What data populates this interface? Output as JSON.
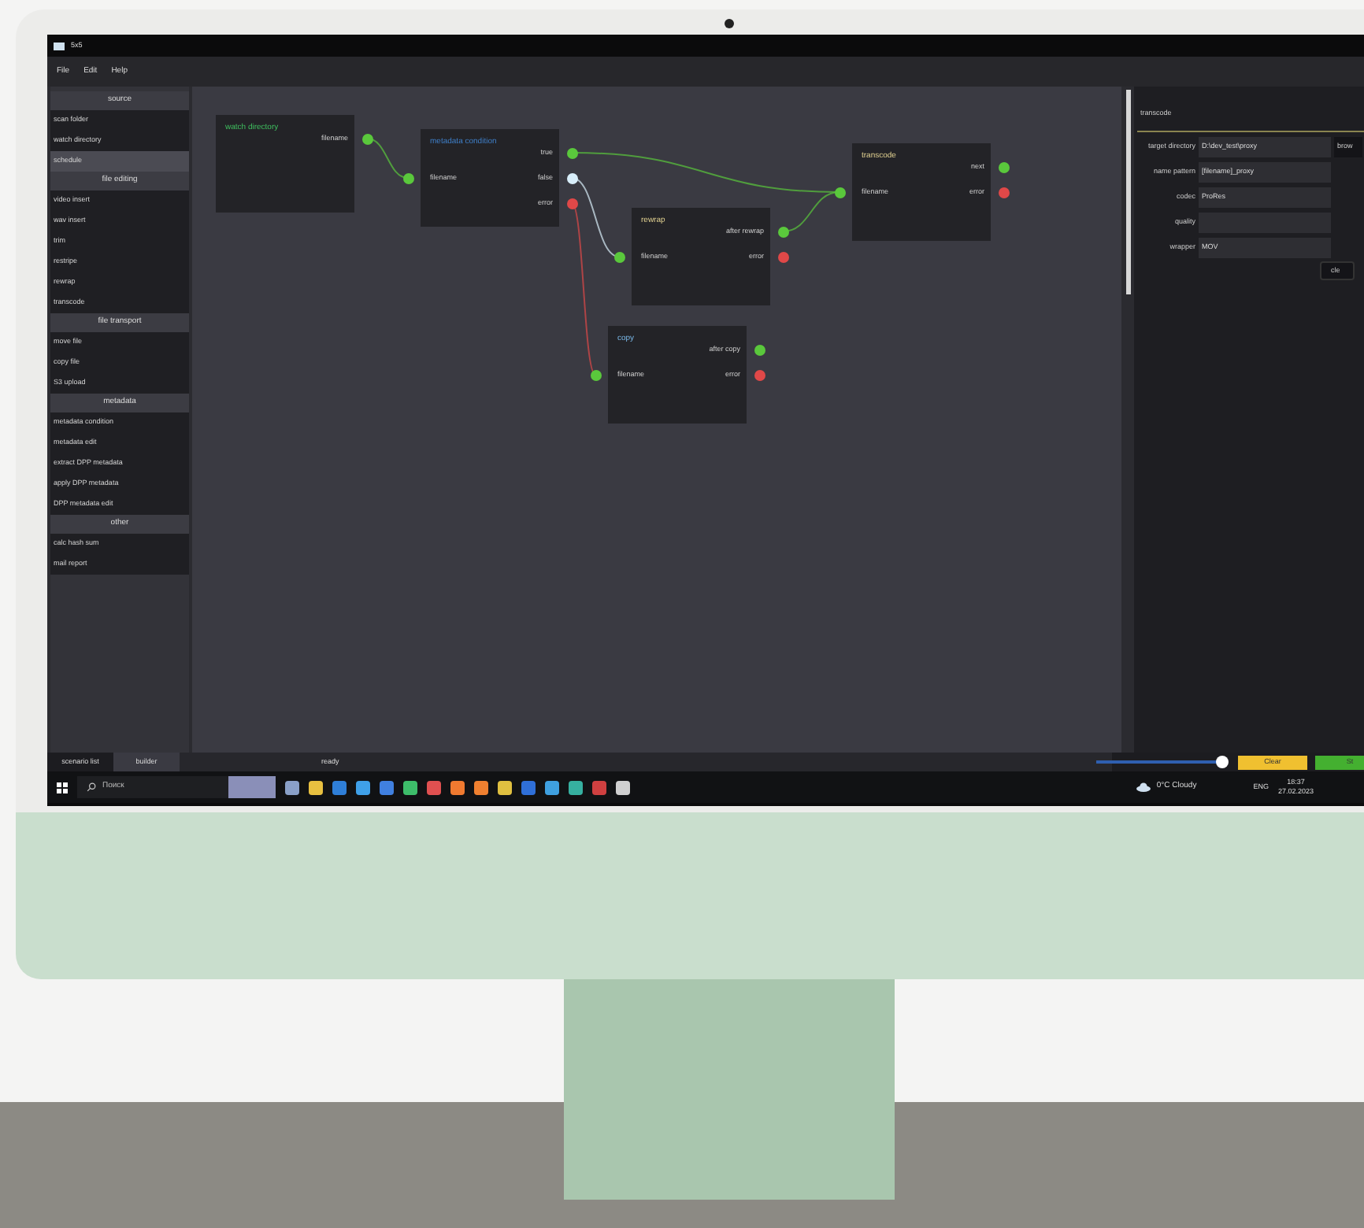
{
  "window": {
    "title": "5x5"
  },
  "menu": [
    "File",
    "Edit",
    "Help"
  ],
  "sidebar": [
    {
      "title": "source",
      "items": [
        {
          "label": "scan folder",
          "selected": false
        },
        {
          "label": "watch directory",
          "selected": false
        },
        {
          "label": "schedule",
          "selected": true
        }
      ]
    },
    {
      "title": "file editing",
      "items": [
        {
          "label": "video insert",
          "selected": false
        },
        {
          "label": "wav insert",
          "selected": false
        },
        {
          "label": "trim",
          "selected": false
        },
        {
          "label": "restripe",
          "selected": false
        },
        {
          "label": "rewrap",
          "selected": false
        },
        {
          "label": "transcode",
          "selected": false
        }
      ]
    },
    {
      "title": "file transport",
      "items": [
        {
          "label": "move file",
          "selected": false
        },
        {
          "label": "copy file",
          "selected": false
        },
        {
          "label": "S3 upload",
          "selected": false
        }
      ]
    },
    {
      "title": "metadata",
      "items": [
        {
          "label": "metadata condition",
          "selected": false
        },
        {
          "label": "metadata edit",
          "selected": false
        },
        {
          "label": "extract DPP metadata",
          "selected": false
        },
        {
          "label": "apply DPP metadata",
          "selected": false
        },
        {
          "label": "DPP metadata edit",
          "selected": false
        }
      ]
    },
    {
      "title": "other",
      "items": [
        {
          "label": "calc hash sum",
          "selected": false
        },
        {
          "label": "mail report",
          "selected": false
        }
      ]
    }
  ],
  "nodes": [
    {
      "title": "watch directory",
      "kind": "source",
      "outputs": [
        {
          "label": "filename",
          "color": "#5ac83c"
        }
      ]
    },
    {
      "title": "metadata condition",
      "kind": "metadata",
      "inputs": [
        {
          "label": "filename",
          "color": "#5ac83c"
        }
      ],
      "outputs": [
        {
          "label": "true",
          "color": "#5ac83c"
        },
        {
          "label": "false",
          "color": "#d8eefa"
        },
        {
          "label": "error",
          "color": "#e04848"
        }
      ]
    },
    {
      "title": "rewrap",
      "kind": "editing",
      "inputs": [
        {
          "label": "filename",
          "color": "#5ac83c"
        }
      ],
      "outputs": [
        {
          "label": "after rewrap",
          "color": "#5ac83c"
        },
        {
          "label": "error",
          "color": "#e04848"
        }
      ]
    },
    {
      "title": "copy",
      "kind": "transport",
      "inputs": [
        {
          "label": "filename",
          "color": "#5ac83c"
        }
      ],
      "outputs": [
        {
          "label": "after copy",
          "color": "#5ac83c"
        },
        {
          "label": "error",
          "color": "#e04848"
        }
      ]
    },
    {
      "title": "transcode",
      "kind": "editing",
      "inputs": [
        {
          "label": "filename",
          "color": "#5ac83c"
        }
      ],
      "outputs": [
        {
          "label": "next",
          "color": "#5ac83c"
        },
        {
          "label": "error",
          "color": "#e04848"
        }
      ]
    }
  ],
  "properties": {
    "title": "transcode",
    "fields": [
      {
        "label": "target directory",
        "value": "D:\\dev_test\\proxy",
        "button": "brow"
      },
      {
        "label": "name pattern",
        "value": "[filename]_proxy"
      },
      {
        "label": "codec",
        "value": "ProRes"
      },
      {
        "label": "quality"
      },
      {
        "label": "wrapper",
        "value": "MOV"
      }
    ],
    "action": "cle"
  },
  "bottom_tabs": [
    {
      "label": "scenario list",
      "selected": false
    },
    {
      "label": "builder",
      "selected": true
    }
  ],
  "status": "ready",
  "zoom_slider": {
    "level": 1
  },
  "buttons": [
    {
      "label": "Clear",
      "kind": "yellow"
    },
    {
      "label": "St",
      "kind": "green"
    }
  ],
  "taskbar": {
    "search": "Поиск",
    "weather": "0°C Cloudy",
    "language": "ENG",
    "time": "18:37",
    "date": "27.02.2023"
  }
}
